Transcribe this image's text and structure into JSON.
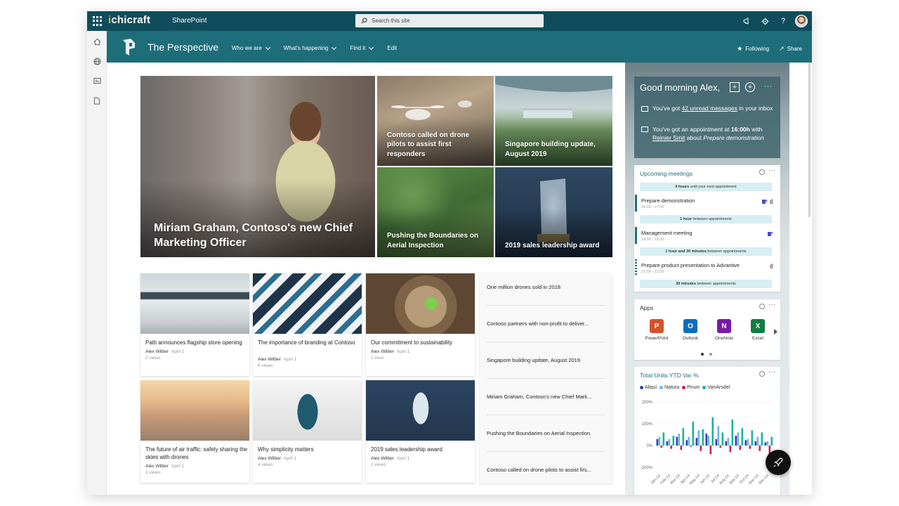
{
  "suitebar": {
    "logo_i": "i",
    "logo_rest": "chicraft",
    "app_name": "SharePoint",
    "search_placeholder": "Search this site",
    "icons": [
      "waffle-icon",
      "megaphone-icon",
      "gear-icon",
      "help-icon"
    ],
    "help_glyph": "?"
  },
  "appbar": {
    "icons": [
      "home-icon",
      "globe-icon",
      "news-icon",
      "document-icon"
    ]
  },
  "site": {
    "title": "The Perspective",
    "nav": [
      {
        "label": "Who we are",
        "dropdown": true
      },
      {
        "label": "What's happening",
        "dropdown": true
      },
      {
        "label": "Find it",
        "dropdown": true
      },
      {
        "label": "Edit",
        "dropdown": false
      }
    ],
    "following": "Following",
    "share": "Share",
    "following_glyph": "★",
    "share_glyph": "↗"
  },
  "hero": {
    "main": "Miriam Graham, Contoso's new Chief Marketing Officer",
    "tiles": [
      "Contoso called on drone pilots to assist first responders",
      "Singapore building update, August 2019",
      "Pushing the Boundaries on Aerial Inspection",
      "2019 sales leadership award"
    ]
  },
  "cards": [
    {
      "title": "Patti announces flagship store opening",
      "author": "Alex Wilber",
      "date": "April 1",
      "views": "2 views"
    },
    {
      "title": "The importance of branding at Contoso",
      "author": "Alex Wilber",
      "date": "April 1",
      "views": "6 views"
    },
    {
      "title": "Our commitment to sustainability",
      "author": "Alex Wilber",
      "date": "April 1",
      "views": "1 view"
    },
    {
      "title": "The future of air traffic: safely sharing the skies with drones",
      "author": "Alex Wilber",
      "date": "April 1",
      "views": "3 views"
    },
    {
      "title": "Why simplicity matters",
      "author": "Alex Wilber",
      "date": "April 1",
      "views": "4 views"
    },
    {
      "title": "2019 sales leadership award",
      "author": "Alex Wilber",
      "date": "April 1",
      "views": "2 views"
    }
  ],
  "newslist": [
    "One million drones sold in 2018",
    "Contoso partners with non-profit to deliver...",
    "Singapore building update, August 2019",
    "Miriam Graham, Contoso's new Chief Mark...",
    "Pushing the Boundaries on Aerial Inspection",
    "Contoso called on drone pilots to assist firs..."
  ],
  "greeting": {
    "title": "Good morning Alex,",
    "more": "···",
    "add_glyph": "+",
    "line1_a": "You've got ",
    "line1_link": "42 unread messages",
    "line1_b": " in your inbox",
    "line2_a": "You've got an appointment at ",
    "line2_time": "16:00h",
    "line2_b": " with ",
    "line2_link": "Reinier Smit",
    "line2_c": " about ",
    "line2_topic": "Prepare demonstration"
  },
  "meetings": {
    "title": "Upcoming meetings",
    "more": "···",
    "bars": [
      {
        "bold": "4 hours",
        "rest": " until your next appointment"
      },
      {
        "bold": "1 hour",
        "rest": " between appointments"
      },
      {
        "bold": "1 hour and 30 minutes",
        "rest": " between appointments"
      },
      {
        "bold": "30 minutes",
        "rest": " between appointments"
      }
    ],
    "items": [
      {
        "title": "Prepare demonstration",
        "time": "16:00 - 17:00"
      },
      {
        "title": "Management meeting",
        "time": "18:00 - 19:30"
      },
      {
        "title": "Prepare product presentation to Advantive",
        "time": "21:00 - 21:30"
      }
    ]
  },
  "apps": {
    "title": "Apps",
    "more": "···",
    "items": [
      {
        "label": "PowerPoint",
        "letter": "P",
        "color": "#d35230"
      },
      {
        "label": "Outlook",
        "letter": "O",
        "color": "#0f6cbd"
      },
      {
        "label": "OneNote",
        "letter": "N",
        "color": "#7719aa"
      },
      {
        "label": "Excel",
        "letter": "X",
        "color": "#107c41"
      }
    ],
    "page": 1,
    "pages": 2
  },
  "chart_widget": {
    "title": "Total Units YTD Var %",
    "more": "···"
  },
  "chart_data": {
    "type": "bar",
    "title": "Total Units YTD Var %",
    "series_names": [
      "Aliqui",
      "Natura",
      "Pirum",
      "VanArsdel"
    ],
    "colors": [
      "#3a3fa8",
      "#6ab4e8",
      "#c1224f",
      "#18b3a3"
    ],
    "categories": [
      "Jan-14",
      "Feb-14",
      "Mar-14",
      "Apr-14",
      "May-14",
      "Jun-14",
      "Jul-14",
      "Aug-14",
      "Sep-14",
      "Oct-14",
      "Nov-14",
      "Dec-14"
    ],
    "yticks": [
      "200%",
      "100%",
      "0%",
      "-100%"
    ],
    "ylim": [
      -100,
      200
    ],
    "series": [
      {
        "name": "Aliqui",
        "values": [
          30,
          20,
          40,
          25,
          35,
          55,
          30,
          20,
          45,
          25,
          20,
          15
        ]
      },
      {
        "name": "Natura",
        "values": [
          40,
          30,
          55,
          40,
          70,
          45,
          90,
          35,
          60,
          30,
          40,
          20
        ]
      },
      {
        "name": "Pirum",
        "values": [
          -10,
          -15,
          -20,
          -5,
          -25,
          -40,
          -10,
          -30,
          -20,
          -15,
          -25,
          -70
        ]
      },
      {
        "name": "VanArsdel",
        "values": [
          60,
          45,
          80,
          110,
          75,
          130,
          60,
          120,
          80,
          70,
          60,
          40
        ]
      }
    ]
  }
}
